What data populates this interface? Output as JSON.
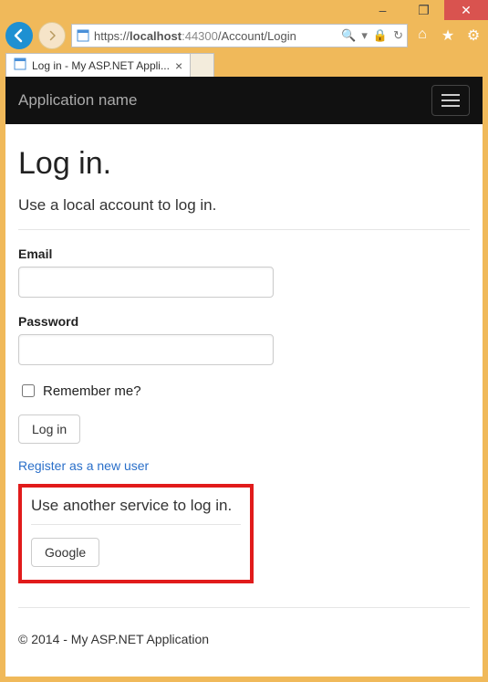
{
  "window": {
    "minimize": "–",
    "maximize": "❐",
    "close": "✕"
  },
  "browser": {
    "url_scheme": "https://",
    "url_host": "localhost",
    "url_port": ":44300",
    "url_path": "/Account/Login",
    "search_glyph": "🔍",
    "lock_glyph": "🔒",
    "refresh_glyph": "↻",
    "home_glyph": "⌂",
    "star_glyph": "★",
    "gear_glyph": "⚙",
    "tab_title": "Log in - My ASP.NET Appli...",
    "tab_close": "×"
  },
  "navbar": {
    "brand": "Application name"
  },
  "page": {
    "heading": "Log in.",
    "subheading": "Use a local account to log in.",
    "email_label": "Email",
    "password_label": "Password",
    "remember_label": "Remember me?",
    "submit_label": "Log in",
    "register_link": "Register as a new user",
    "external_heading": "Use another service to log in.",
    "google_label": "Google",
    "footer": "© 2014 - My ASP.NET Application"
  }
}
